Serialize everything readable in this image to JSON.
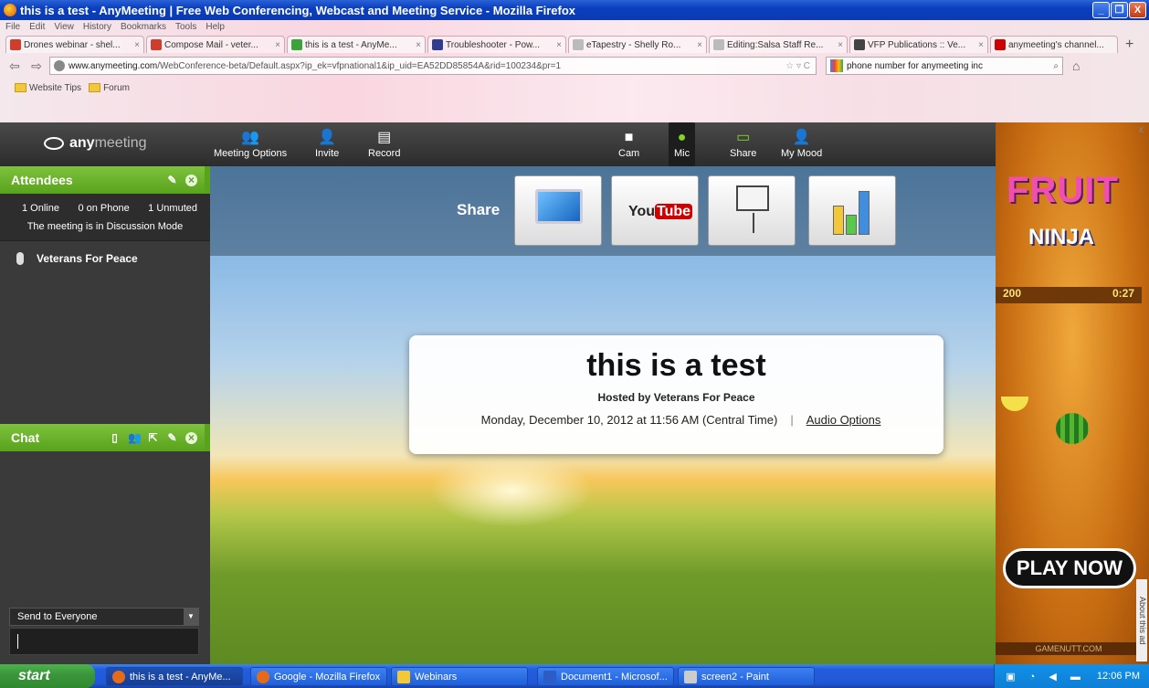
{
  "window": {
    "title": "this is a test - AnyMeeting | Free Web Conferencing, Webcast and Meeting Service - Mozilla Firefox",
    "controls": [
      "_",
      "❐",
      "X"
    ]
  },
  "menu": [
    "File",
    "Edit",
    "View",
    "History",
    "Bookmarks",
    "Tools",
    "Help"
  ],
  "tabs": [
    {
      "label": "Drones webinar - shel...",
      "icon_color": "#d23c2c"
    },
    {
      "label": "Compose Mail - veter...",
      "icon_color": "#d23c2c"
    },
    {
      "label": "this is a test - AnyMe...",
      "icon_color": "#3aa33a",
      "active": true
    },
    {
      "label": "Troubleshooter - Pow...",
      "icon_color": "#2f3c8f"
    },
    {
      "label": "eTapestry - Shelly Ro...",
      "icon_color": "#bbbbbb"
    },
    {
      "label": "Editing:Salsa Staff Re...",
      "icon_color": "#bbbbbb"
    },
    {
      "label": "VFP Publications :: Ve...",
      "icon_color": "#444444"
    },
    {
      "label": "anymeeting's channel...",
      "icon_color": "#d10000"
    }
  ],
  "address": {
    "domain": "www.anymeeting.com",
    "path": "/WebConference-beta/Default.aspx?ip_ek=vfpnational1&ip_uid=EA52DD85854A&rid=100234&pr=1"
  },
  "search": {
    "value": "phone number for anymeeting inc"
  },
  "bookmarks": [
    "Website Tips",
    "Forum"
  ],
  "app": {
    "logo_a": "any",
    "logo_b": "meeting",
    "toolbar_left": [
      {
        "label": "Meeting Options",
        "icon": "people-mic-icon"
      },
      {
        "label": "Invite",
        "icon": "add-user-icon"
      },
      {
        "label": "Record",
        "icon": "film-icon"
      }
    ],
    "toolbar_right": [
      {
        "label": "Cam",
        "icon": "camera-icon"
      },
      {
        "label": "Mic",
        "icon": "mic-icon"
      },
      {
        "label": "Share",
        "icon": "monitor-icon"
      },
      {
        "label": "My Mood",
        "icon": "person-icon"
      }
    ]
  },
  "attendees": {
    "title": "Attendees",
    "online": "1 Online",
    "phone": "0 on Phone",
    "unmuted": "1 Unmuted",
    "mode": "The meeting is in Discussion Mode",
    "list": [
      "Veterans For Peace"
    ]
  },
  "chat": {
    "title": "Chat",
    "send_to": "Send to Everyone",
    "input_value": ""
  },
  "share": {
    "label": "Share",
    "items": [
      "desktop-share",
      "youtube",
      "presentation",
      "chart"
    ],
    "youtube_a": "You",
    "youtube_b": "Tube"
  },
  "meeting": {
    "title": "this is a test",
    "host": "Hosted by Veterans For Peace",
    "datetime": "Monday, December 10, 2012 at 11:56 AM (Central Time)",
    "separator": "|",
    "audio_link": "Audio Options"
  },
  "ad": {
    "title1": "FRUIT",
    "title2": "NINJA",
    "score": "200",
    "timer": "0:27",
    "cta": "PLAY NOW",
    "brand": "GAMENUTT.COM",
    "about": "About this ad",
    "close": "x"
  },
  "taskbar": {
    "start": "start",
    "tasks": [
      {
        "label": "this is a test - AnyMe...",
        "icon_color": "#e56b1a",
        "active": true
      },
      {
        "label": "Google - Mozilla Firefox",
        "icon_color": "#e56b1a"
      },
      {
        "label": "Webinars",
        "icon_color": "#f2c73a"
      },
      {
        "label": "Document1 - Microsof...",
        "icon_color": "#2c5cc5"
      },
      {
        "label": "screen2 - Paint",
        "icon_color": "#cccccc"
      }
    ],
    "clock": "12:06 PM"
  }
}
